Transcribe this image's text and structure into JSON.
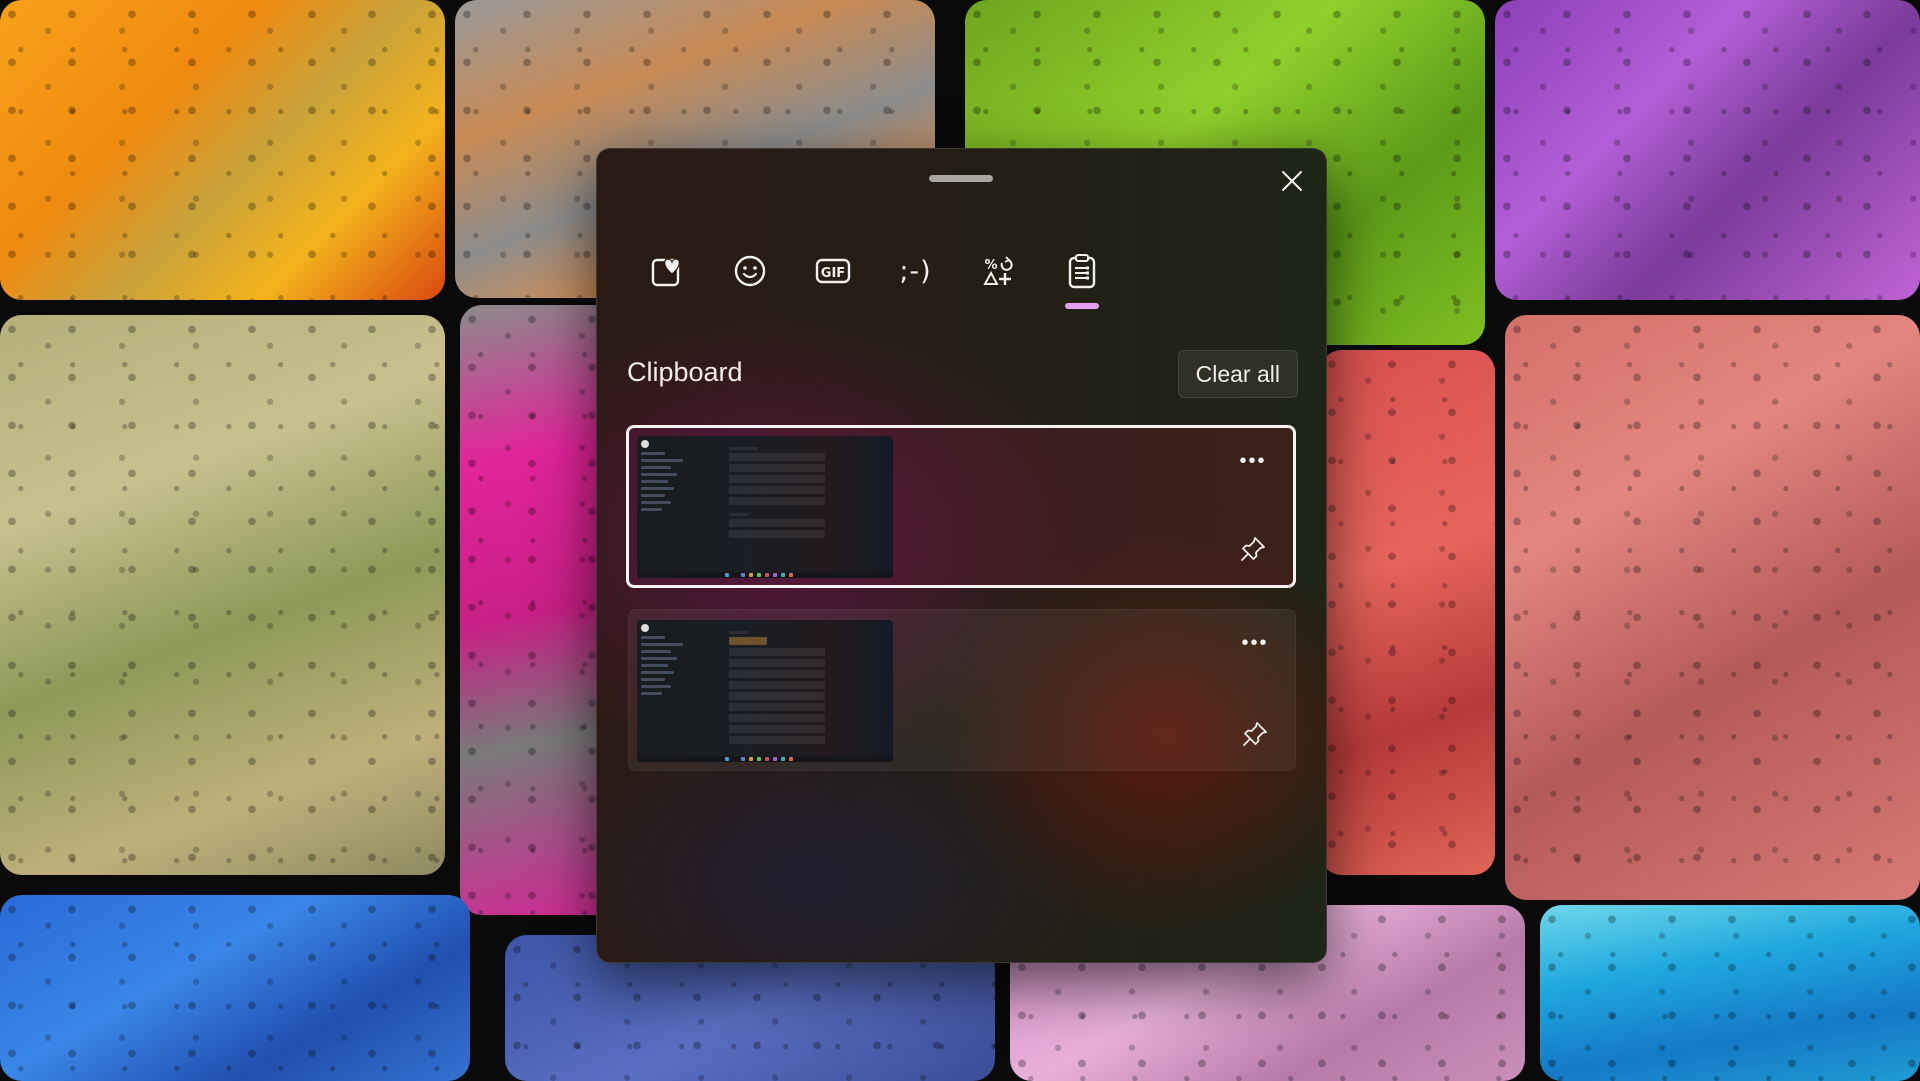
{
  "window": {
    "title": "Clipboard",
    "close_label": "Close"
  },
  "tabs": [
    {
      "id": "kaomoji-favorites",
      "icon": "sticker-heart-icon",
      "label": "Stickers",
      "active": false
    },
    {
      "id": "emoji",
      "icon": "smiley-icon",
      "label": "Emoji",
      "active": false
    },
    {
      "id": "gif",
      "icon": "gif-icon",
      "label": "GIF",
      "glyph": "GIF",
      "active": false
    },
    {
      "id": "kaomoji",
      "icon": "kaomoji-icon",
      "label": "Kaomoji",
      "glyph": ";-)",
      "active": false
    },
    {
      "id": "symbols",
      "icon": "symbols-icon",
      "label": "Symbols",
      "active": false
    },
    {
      "id": "clipboard",
      "icon": "clipboard-icon",
      "label": "Clipboard history",
      "active": true
    }
  ],
  "clipboard": {
    "heading": "Clipboard",
    "clear_all_label": "Clear all",
    "items": [
      {
        "type": "image",
        "description": "Screenshot of settings window",
        "selected": true,
        "more_label": "•••",
        "pinned": false
      },
      {
        "type": "image",
        "description": "Screenshot of settings list window",
        "selected": false,
        "more_label": "•••",
        "pinned": false
      }
    ]
  },
  "colors": {
    "accent_indicator": "#e6a0ee",
    "selected_border": "#f7f3f3",
    "text": "#f3ecea"
  }
}
